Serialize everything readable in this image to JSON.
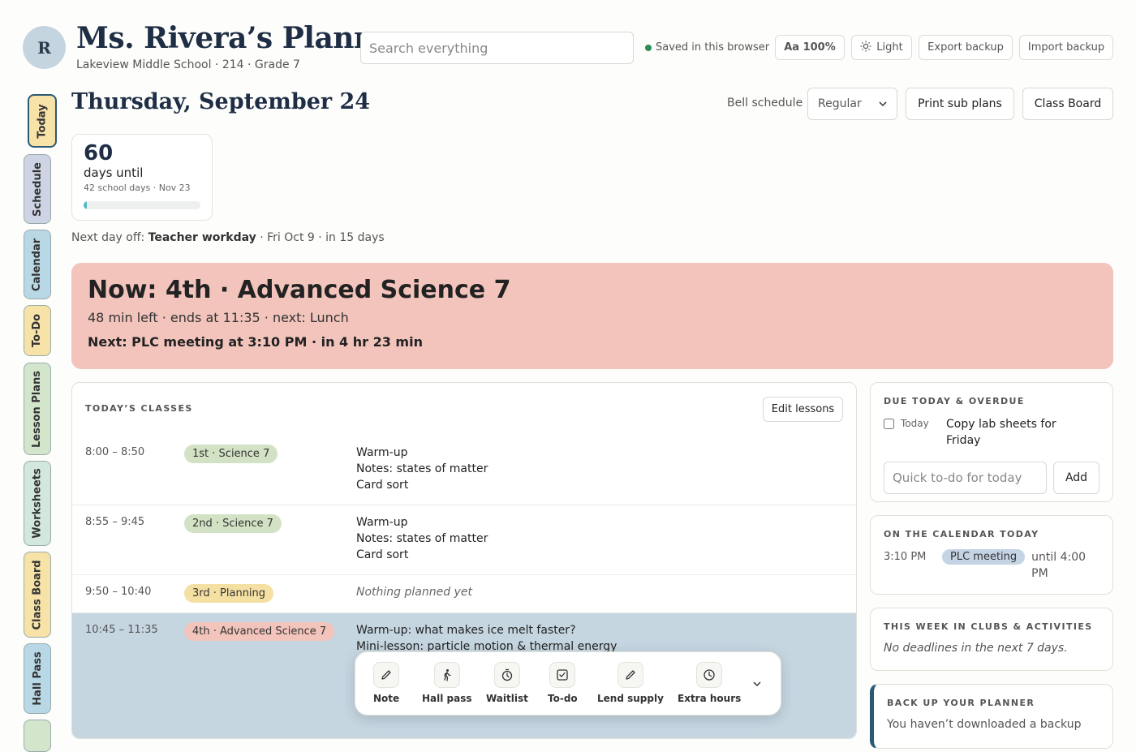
{
  "header": {
    "avatar_initial": "R",
    "title": "Ms. Rivera’s Planner",
    "subtitle": "Lakeview Middle School · 214 · Grade 7",
    "search_placeholder": "Search everything",
    "saved_status": "Saved in this browser",
    "font_size_label": "Aa 100%",
    "theme_label": "Light",
    "export_label": "Export backup",
    "import_label": "Import backup"
  },
  "sidebar": {
    "tabs": [
      {
        "label": "Today",
        "color": "#f7e2a8"
      },
      {
        "label": "Schedule",
        "color": "#cfd4e4"
      },
      {
        "label": "Calendar",
        "color": "#b9d8e6"
      },
      {
        "label": "To-Do",
        "color": "#f7e2a8"
      },
      {
        "label": "Lesson Plans",
        "color": "#d3e6cc"
      },
      {
        "label": "Worksheets",
        "color": "#d2e8dc"
      },
      {
        "label": "Class Board",
        "color": "#f7e2a8"
      },
      {
        "label": "Hall Pass",
        "color": "#b9d8e6"
      }
    ]
  },
  "day": {
    "date_title": "Thursday, September 24",
    "bell_label": "Bell schedule",
    "bell_value": "Regular",
    "print_label": "Print sub plans",
    "board_label": "Class Board"
  },
  "countdown": {
    "number": "60",
    "label": "days until",
    "detail": "42 school days · Nov 23",
    "progress": 0.03
  },
  "next_day_off": {
    "prefix": "Next day off:",
    "name": "Teacher workday",
    "suffix": "· Fri Oct 9 · in 15 days"
  },
  "now": {
    "title": "Now: 4th · Advanced Science 7",
    "detail": "48 min left · ends at 11:35 · next: Lunch",
    "next": "Next: PLC meeting at 3:10 PM · in 4 hr 23 min"
  },
  "classes": {
    "title": "TODAY’S CLASSES",
    "edit_label": "Edit lessons",
    "rows": [
      {
        "time": "8:00 – 8:50",
        "period": "1st · Science 7",
        "lines": [
          "Warm-up",
          "Notes: states of matter",
          "Card sort"
        ]
      },
      {
        "time": "8:55 – 9:45",
        "period": "2nd · Science 7",
        "lines": [
          "Warm-up",
          "Notes: states of matter",
          "Card sort"
        ]
      },
      {
        "time": "9:50 – 10:40",
        "period": "3rd · Planning",
        "lines": [
          "Nothing planned yet"
        ]
      },
      {
        "time": "10:45 – 11:35",
        "period": "4th · Advanced Science 7",
        "lines": [
          "Warm-up: what makes ice melt faster?",
          "Mini-lesson: particle motion & thermal energy"
        ]
      }
    ]
  },
  "toolbar": {
    "items": [
      {
        "label": "Note",
        "icon": "pencil-icon"
      },
      {
        "label": "Hall pass",
        "icon": "walking-person-icon"
      },
      {
        "label": "Waitlist",
        "icon": "stopwatch-icon"
      },
      {
        "label": "To-do",
        "icon": "checkbox-icon"
      },
      {
        "label": "Lend supply",
        "icon": "pencil-icon"
      },
      {
        "label": "Extra hours",
        "icon": "clock-icon"
      }
    ],
    "more_icon": "⌄"
  },
  "due": {
    "title": "DUE TODAY & OVERDUE",
    "items": [
      {
        "when": "Today",
        "text": "Copy lab sheets for Friday"
      }
    ],
    "quick_placeholder": "Quick to-do for today",
    "add_label": "Add"
  },
  "calendar_today": {
    "title": "ON THE CALENDAR TODAY",
    "time": "3:10 PM",
    "event": "PLC meeting",
    "until": "until 4:00 PM"
  },
  "clubs": {
    "title": "THIS WEEK IN CLUBS & ACTIVITIES",
    "note": "No deadlines in the next 7 days."
  },
  "backup": {
    "title": "BACK UP YOUR PLANNER",
    "text": "You haven’t downloaded a backup"
  }
}
